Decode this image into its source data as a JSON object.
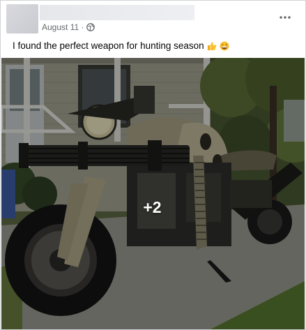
{
  "post": {
    "date": "August 11 ·",
    "caption": "I found the perfect weapon for hunting season",
    "more_photos_label": "+2",
    "icons": {
      "privacy": "globe-icon",
      "menu": "more-options-icon",
      "emoji_1": "thumbs-up-emoji",
      "emoji_2": "grinning-face-emoji"
    },
    "colors": {
      "meta_text": "#65676b",
      "text": "#050505",
      "photo_overlay": "rgba(0,0,0,0.35)"
    }
  }
}
